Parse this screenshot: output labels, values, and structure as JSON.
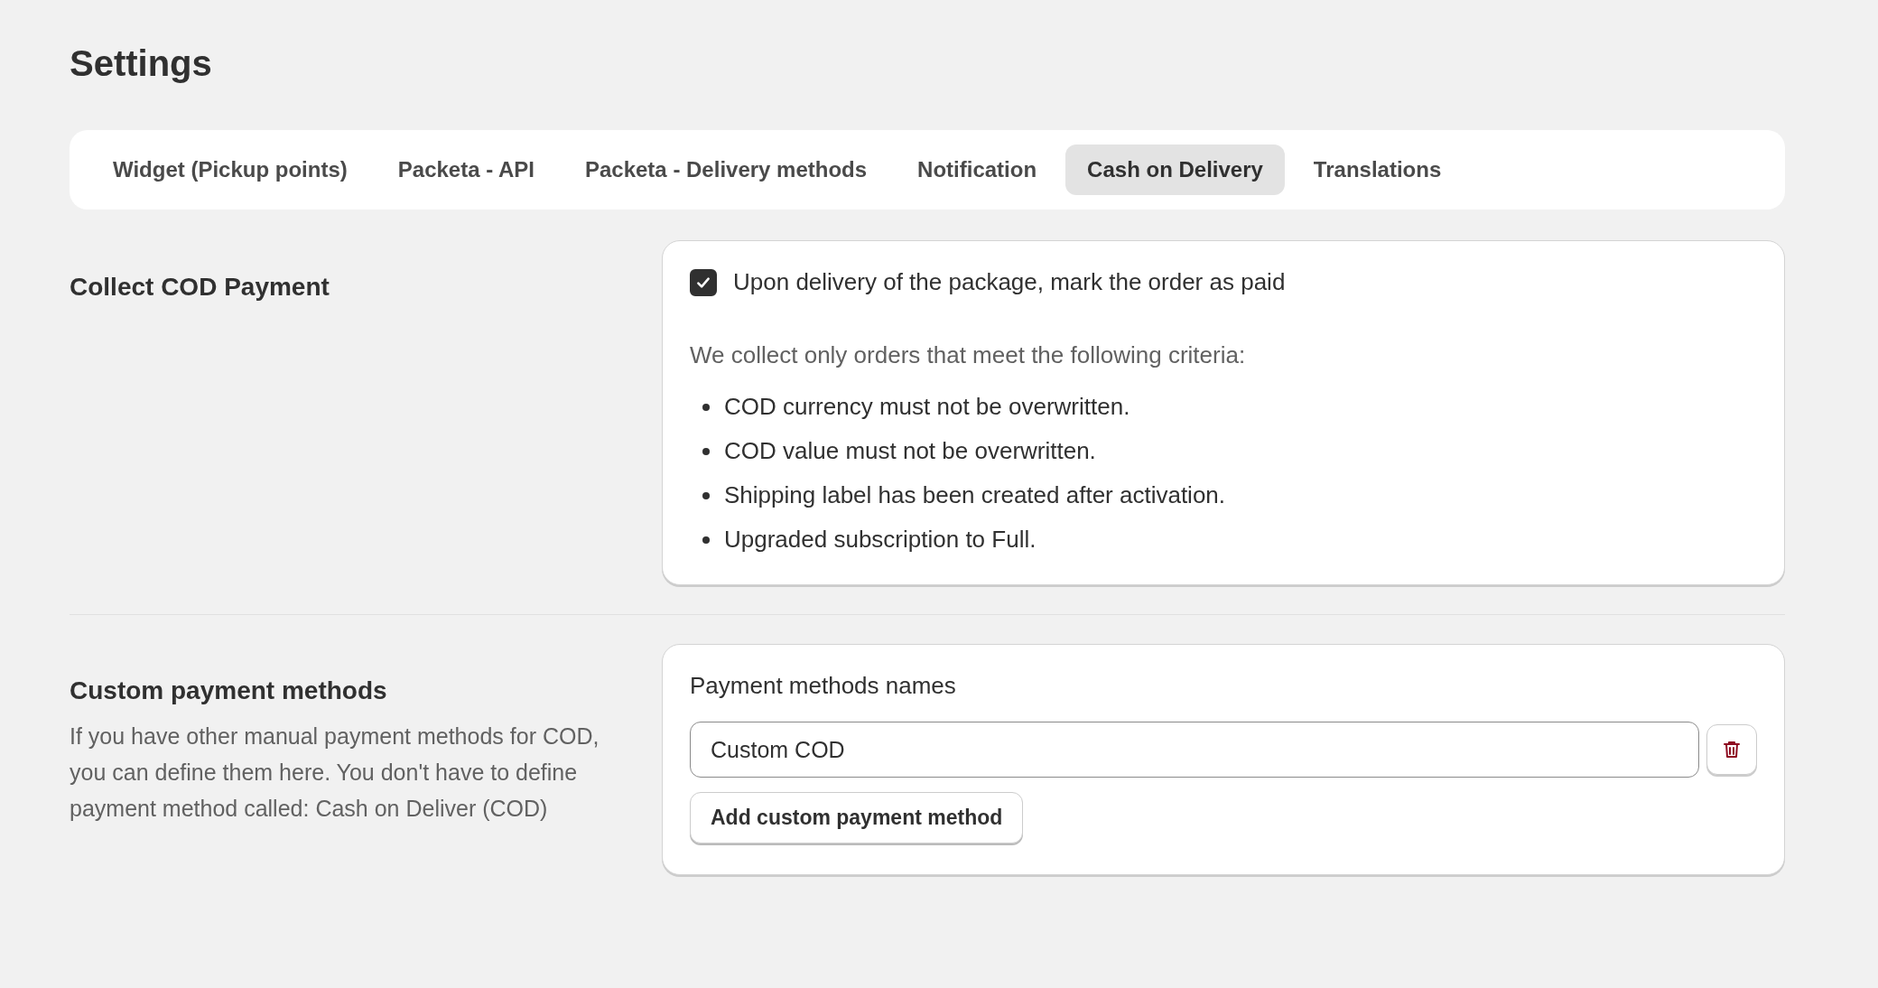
{
  "page_title": "Settings",
  "tabs": [
    {
      "label": "Widget (Pickup points)",
      "selected": false
    },
    {
      "label": "Packeta - API",
      "selected": false
    },
    {
      "label": "Packeta - Delivery methods",
      "selected": false
    },
    {
      "label": "Notification",
      "selected": false
    },
    {
      "label": "Cash on Delivery",
      "selected": true
    },
    {
      "label": "Translations",
      "selected": false
    }
  ],
  "collect_section": {
    "title": "Collect COD Payment",
    "checkbox": {
      "label": "Upon delivery of the package, mark the order as paid",
      "checked": true
    },
    "criteria_intro": "We collect only orders that meet the following criteria:",
    "criteria": [
      "COD currency must not be overwritten.",
      "COD value must not be overwritten.",
      "Shipping label has been created after activation.",
      "Upgraded subscription to Full."
    ]
  },
  "custom_section": {
    "title": "Custom payment methods",
    "description": "If you have other manual payment methods for COD, you can define them here. You don't have to define payment method called: Cash on Deliver (COD)",
    "field_label": "Payment methods names",
    "methods": [
      {
        "value": "Custom COD"
      }
    ],
    "add_button": "Add custom payment method"
  }
}
